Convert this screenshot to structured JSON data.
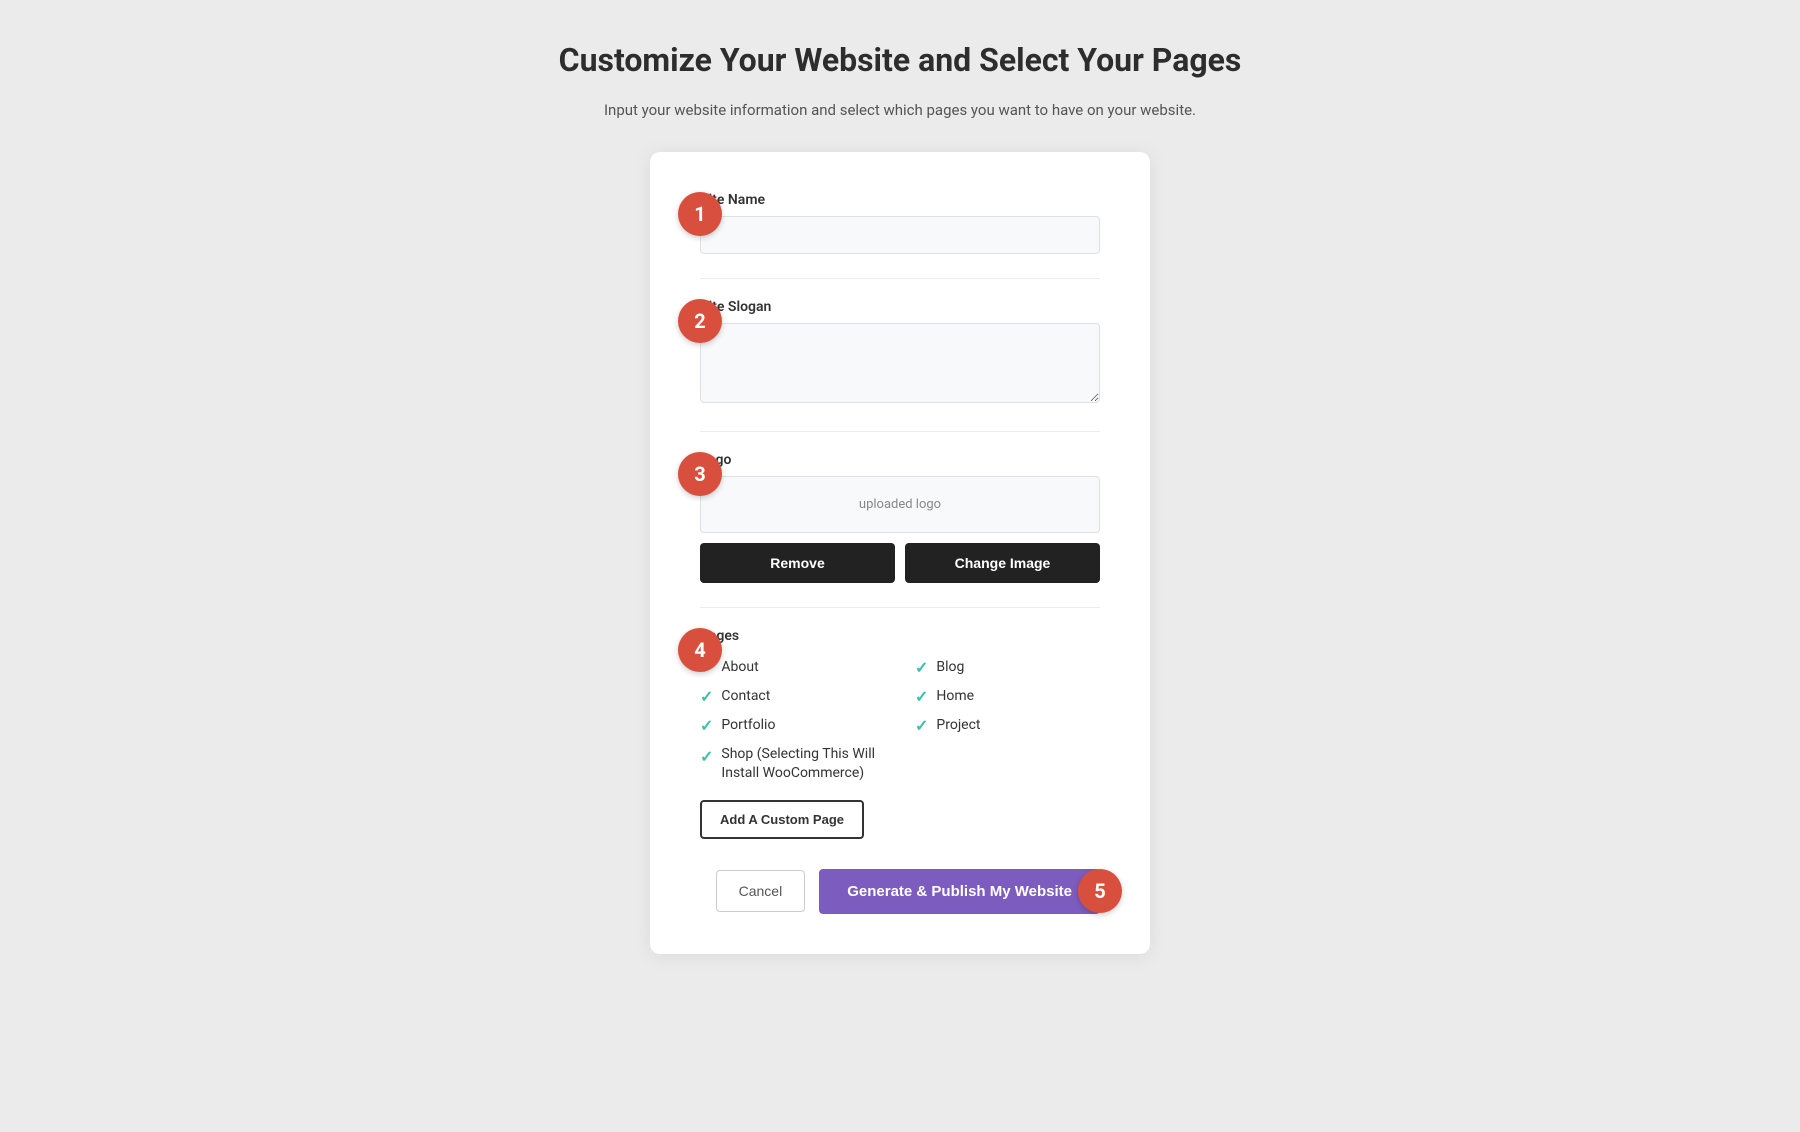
{
  "header": {
    "title": "Customize Your Website and Select Your Pages",
    "subtitle": "Input your website information and select which pages you want to have on your website."
  },
  "steps": {
    "badge1": "1",
    "badge2": "2",
    "badge3": "3",
    "badge4": "4",
    "badge5": "5"
  },
  "form": {
    "site_name_label": "Site Name",
    "site_name_placeholder": "",
    "site_slogan_label": "Site Slogan",
    "site_slogan_placeholder": "",
    "logo_label": "Logo",
    "logo_preview_text": "uploaded logo",
    "remove_button": "Remove",
    "change_image_button": "Change Image",
    "pages_label": "Pages",
    "pages": [
      {
        "label": "About",
        "checked": true
      },
      {
        "label": "Blog",
        "checked": true
      },
      {
        "label": "Contact",
        "checked": true
      },
      {
        "label": "Home",
        "checked": true
      },
      {
        "label": "Portfolio",
        "checked": true
      },
      {
        "label": "Project",
        "checked": true
      }
    ],
    "shop_label": "Shop (Selecting This Will Install WooCommerce)",
    "shop_checked": true,
    "add_custom_page_button": "Add A Custom Page"
  },
  "footer": {
    "cancel_button": "Cancel",
    "publish_button": "Generate & Publish My Website"
  }
}
